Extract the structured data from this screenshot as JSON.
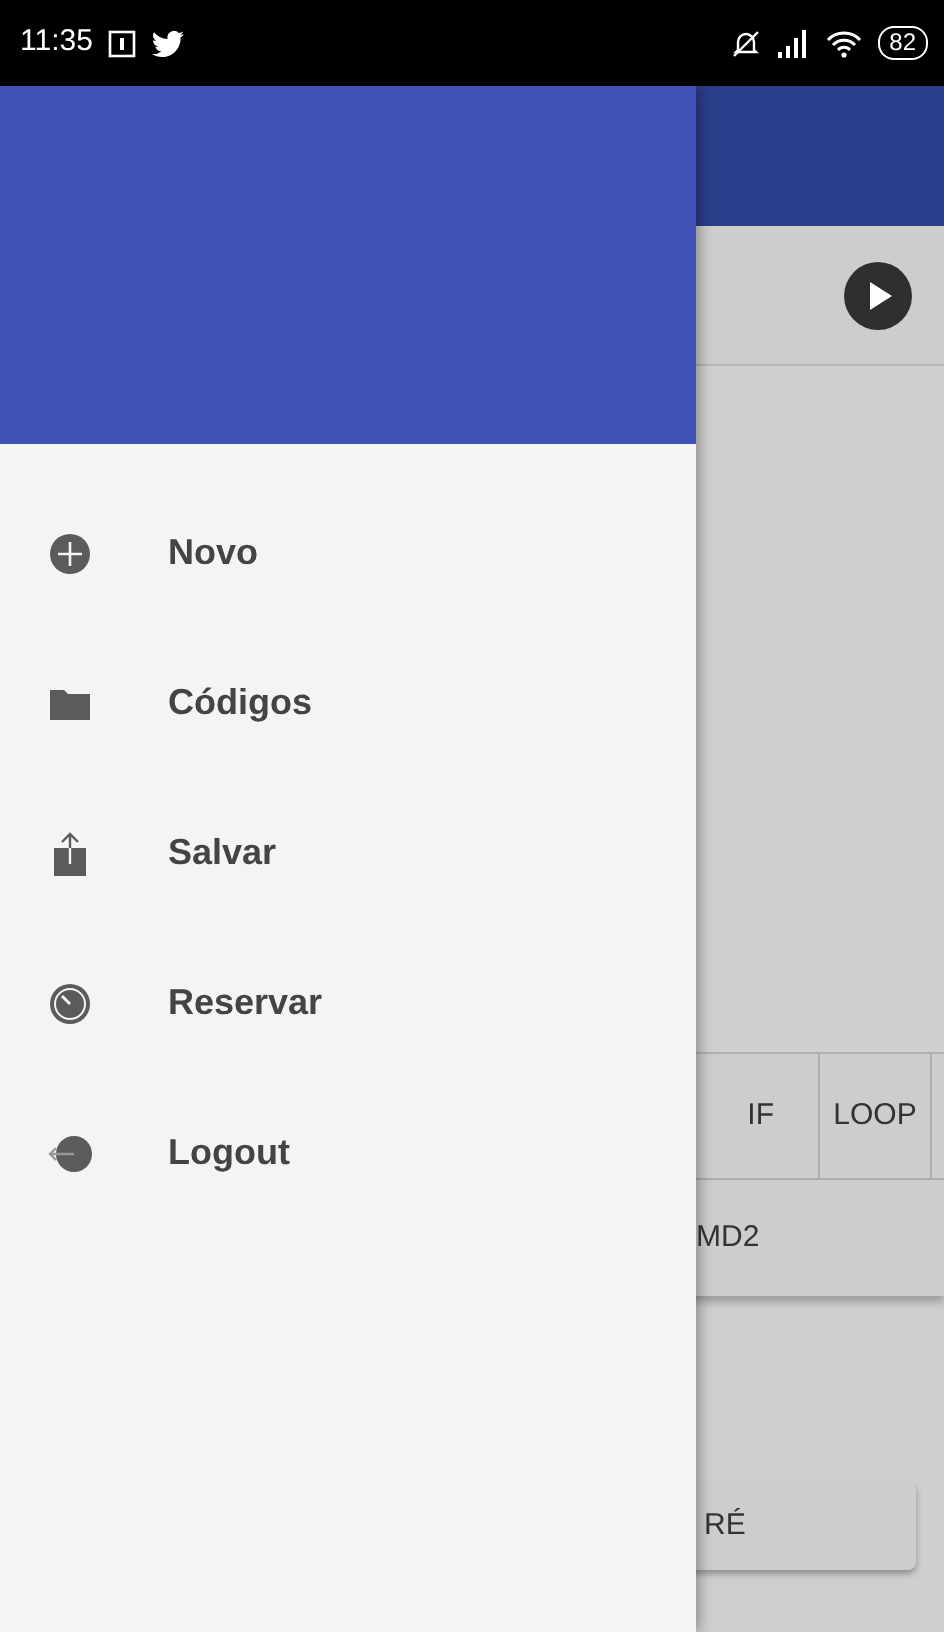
{
  "status_bar": {
    "time": "11:35",
    "battery": "82"
  },
  "background": {
    "blocks": [
      "IF",
      "LOOP"
    ],
    "row_label": "MD2",
    "button": "RÉ"
  },
  "drawer": {
    "items": [
      {
        "label": "Novo"
      },
      {
        "label": "Códigos"
      },
      {
        "label": "Salvar"
      },
      {
        "label": "Reservar"
      },
      {
        "label": "Logout"
      }
    ]
  }
}
